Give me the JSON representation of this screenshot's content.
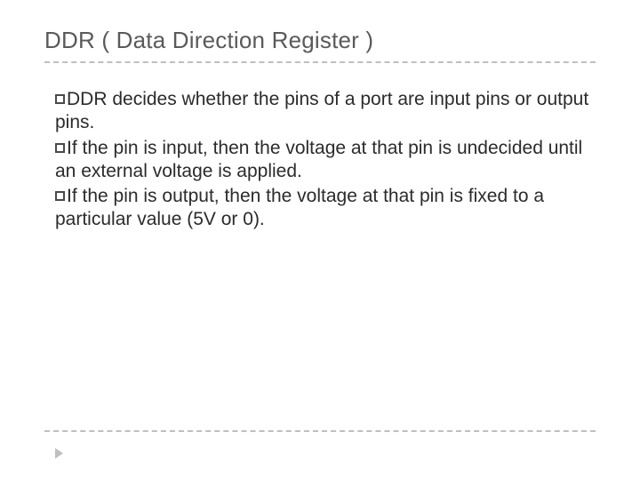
{
  "slide": {
    "title": "DDR ( Data Direction Register )",
    "bullets": [
      "DDR decides whether the pins of a port are input pins or output pins.",
      "If the pin is input, then the voltage at that pin is undecided until an external voltage is applied.",
      "If the pin is output, then the voltage at that pin is fixed to a particular value (5V or 0)."
    ]
  }
}
